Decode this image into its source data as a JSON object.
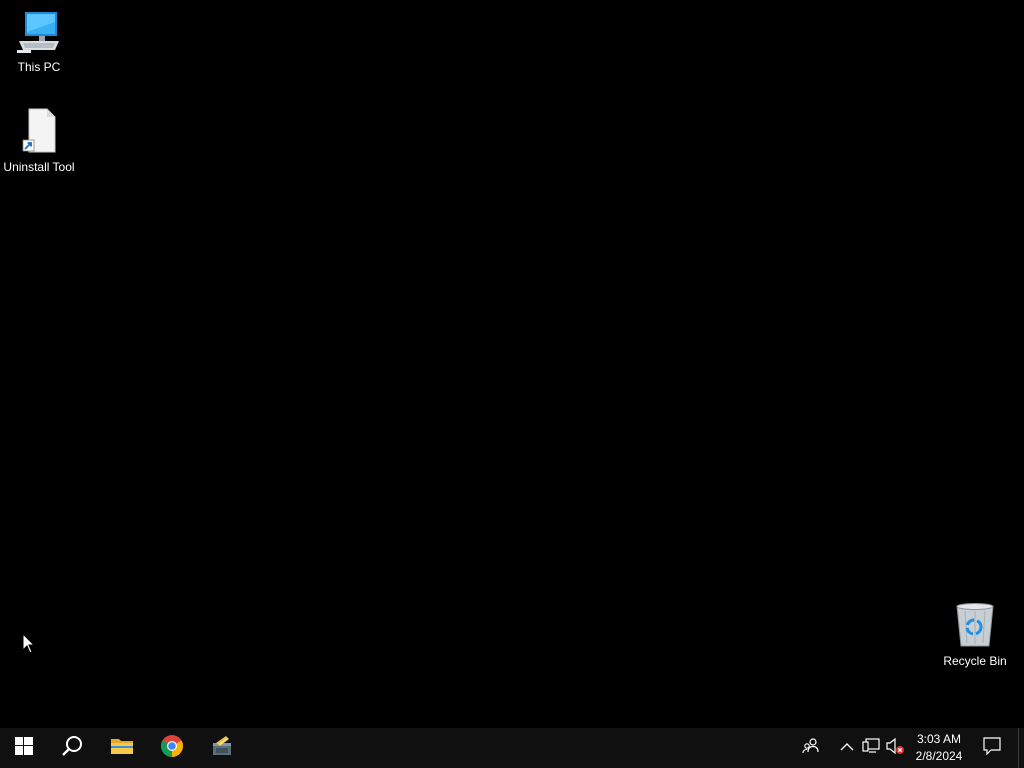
{
  "desktop": {
    "icons": [
      {
        "label": "This PC",
        "icon": "monitor-icon"
      },
      {
        "label": "Uninstall Tool",
        "icon": "blank-document-shortcut-icon"
      },
      {
        "label": "Recycle Bin",
        "icon": "recycle-bin-icon"
      }
    ]
  },
  "taskbar": {
    "pinned": [
      {
        "name": "Start",
        "icon": "windows-logo-icon"
      },
      {
        "name": "Search",
        "icon": "search-icon"
      },
      {
        "name": "File Explorer",
        "icon": "folder-icon"
      },
      {
        "name": "Google Chrome",
        "icon": "chrome-icon"
      },
      {
        "name": "App",
        "icon": "app-icon"
      }
    ],
    "tray": {
      "icons": [
        "people-icon",
        "chevron-up-icon",
        "network-icon",
        "volume-muted-icon"
      ],
      "time": "3:03 AM",
      "date": "2/8/2024",
      "notification_icon": "notification-icon"
    }
  },
  "colors": {
    "desktop_background": "#000000",
    "taskbar_background": "#101010",
    "accent_blue": "#1e90e6",
    "muted_red": "#e03030"
  }
}
